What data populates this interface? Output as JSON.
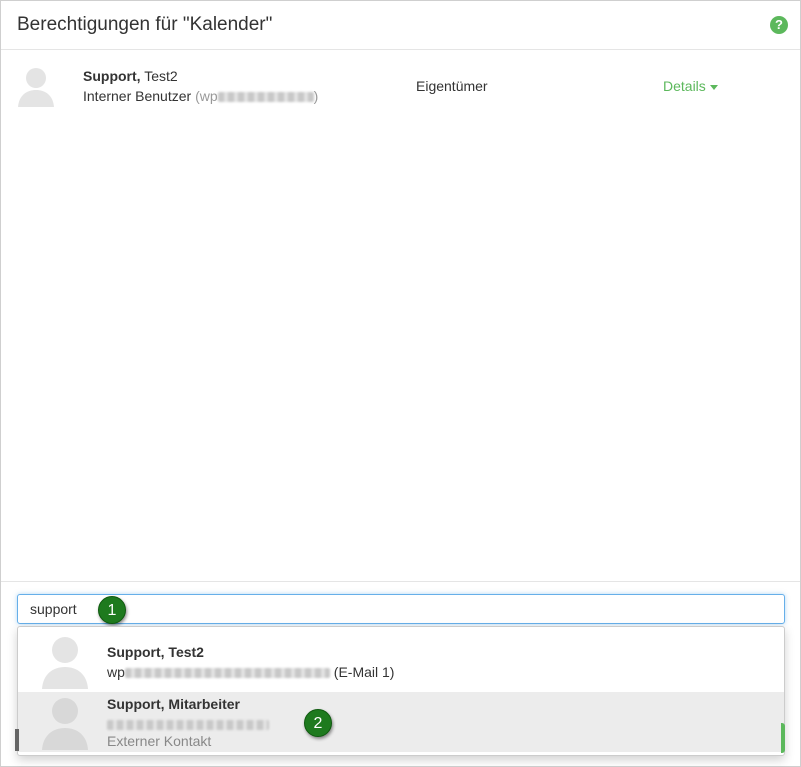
{
  "dialog": {
    "title": "Berechtigungen für \"Kalender\"",
    "help_icon": "question-circle-icon"
  },
  "permissions": [
    {
      "last_name": "Support,",
      "first_name": "Test2",
      "type_label": "Interner Benutzer",
      "id_prefix": "(wp",
      "id_suffix": ")",
      "role": "Eigentümer",
      "details_label": "Details"
    }
  ],
  "search": {
    "value": "support"
  },
  "suggestions": [
    {
      "name": "Support, Test2",
      "email_prefix": "wp",
      "email_suffix": "(E-Mail 1)",
      "type": ""
    },
    {
      "name": "Support, Mitarbeiter",
      "email_prefix": "",
      "email_suffix": "",
      "type": "Externer Kontakt"
    }
  ],
  "markers": [
    "1",
    "2"
  ],
  "colors": {
    "accent": "#5cb85c",
    "marker": "#1e7a1e",
    "focus": "#66afe9"
  }
}
